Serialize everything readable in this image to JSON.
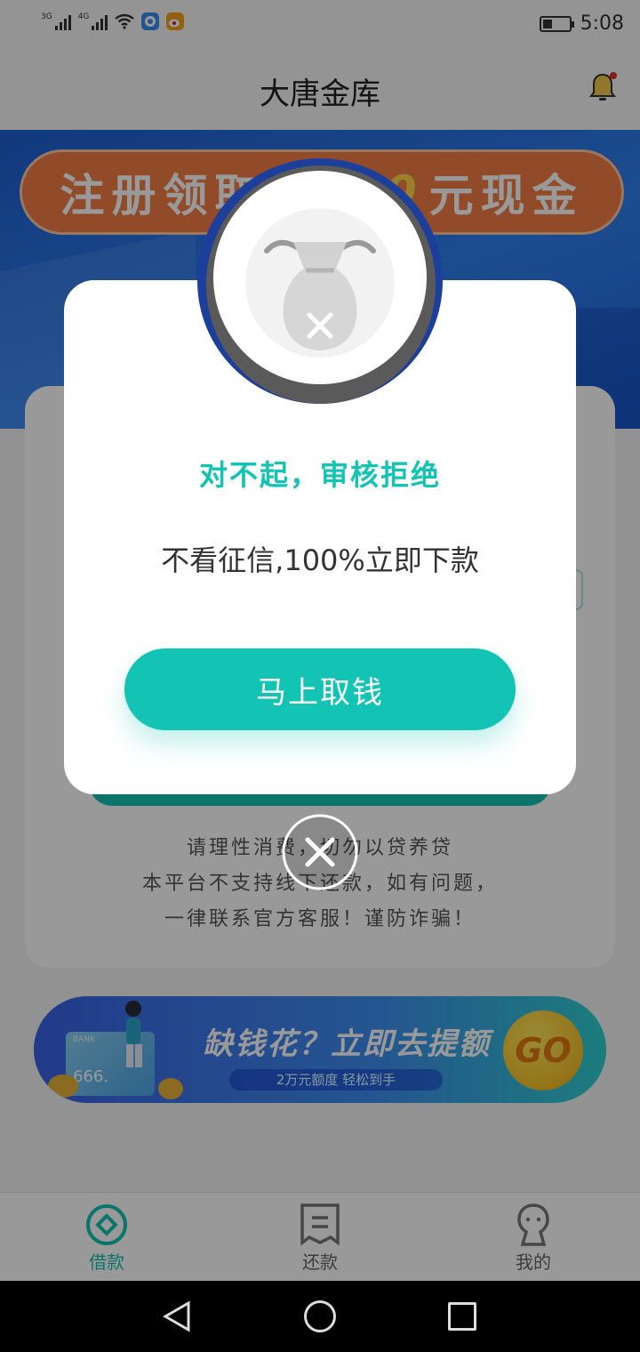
{
  "status_bar": {
    "signal_1_label": "3G",
    "signal_2_label": "4G",
    "time": "5:08",
    "icons": [
      "signal-icon",
      "wifi-icon",
      "browser-icon",
      "weibo-icon",
      "battery-icon"
    ]
  },
  "header": {
    "title": "大唐金库",
    "bell_icon": "bell-icon",
    "notification_dot_color": "#e0312b"
  },
  "hero": {
    "promo_prefix": "注册领取",
    "promo_amount": "2000",
    "promo_suffix": "元现金"
  },
  "main_card": {
    "notice_line1": "请理性消费，切勿以贷养贷",
    "notice_line2": "本平台不支持线下还款，如有问题，",
    "notice_line3": "一律联系官方客服！谨防诈骗！"
  },
  "banner": {
    "bank_label": "BANK",
    "card_number": "666.",
    "title": "缺钱花？立即去提额",
    "subtitle": "2万元额度 轻松到手",
    "go_label": "GO"
  },
  "tabbar": {
    "tabs": [
      {
        "label": "借款",
        "icon": "loan-icon",
        "active": true
      },
      {
        "label": "还款",
        "icon": "receipt-icon",
        "active": false
      },
      {
        "label": "我的",
        "icon": "profile-icon",
        "active": false
      }
    ]
  },
  "dialog": {
    "title": "对不起，审核拒绝",
    "message": "不看征信,100%立即下款",
    "button_label": "马上取钱",
    "badge_icon": "money-bag-rejected-icon",
    "close_icon": "close-icon"
  },
  "colors": {
    "accent": "#13c4b4",
    "promo_orange": "#f47e44",
    "hero_blue": "#2f80f0",
    "overlay": "rgba(0,0,0,0.40)"
  }
}
